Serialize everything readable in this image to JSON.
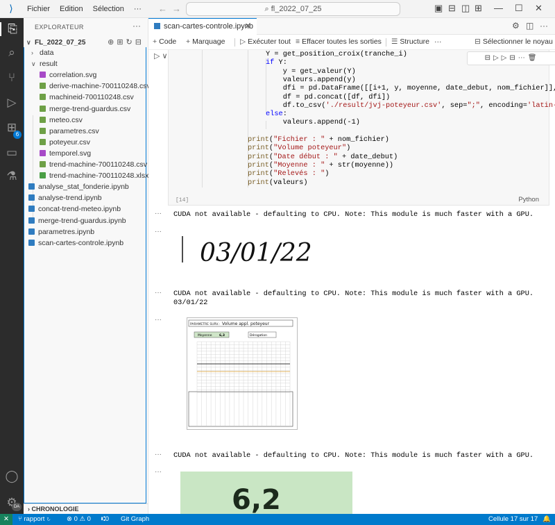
{
  "titlebar": {
    "menus": [
      "Fichier",
      "Edition",
      "Sélection",
      "···"
    ],
    "search": "fl_2022_07_25"
  },
  "sidebar": {
    "title": "EXPLORATEUR",
    "folder": "FL_2022_07_25",
    "items": [
      {
        "label": "data",
        "type": "folder-collapsed"
      },
      {
        "label": "result",
        "type": "folder-open"
      },
      {
        "label": "correlation.svg",
        "type": "svg"
      },
      {
        "label": "derive-machine-700110248.csv",
        "type": "csv"
      },
      {
        "label": "machineid-700110248.csv",
        "type": "csv"
      },
      {
        "label": "merge-trend-guardus.csv",
        "type": "csv"
      },
      {
        "label": "meteo.csv",
        "type": "csv"
      },
      {
        "label": "parametres.csv",
        "type": "csv"
      },
      {
        "label": "poteyeur.csv",
        "type": "csv"
      },
      {
        "label": "temporel.svg",
        "type": "svg"
      },
      {
        "label": "trend-machine-700110248.csv",
        "type": "csv"
      },
      {
        "label": "trend-machine-700110248.xlsx",
        "type": "xl"
      },
      {
        "label": "analyse_stat_fonderie.ipynb",
        "type": "nb"
      },
      {
        "label": "analyse-trend.ipynb",
        "type": "nb"
      },
      {
        "label": "concat-trend-meteo.ipynb",
        "type": "nb"
      },
      {
        "label": "merge-trend-guardus.ipynb",
        "type": "nb"
      },
      {
        "label": "parametres.ipynb",
        "type": "nb"
      },
      {
        "label": "scan-cartes-controle.ipynb",
        "type": "nb"
      }
    ],
    "chronologie": "CHRONOLOGIE"
  },
  "activity": {
    "badge": "6",
    "account_badge": "DA"
  },
  "tab": {
    "label": "scan-cartes-controle.ipynb"
  },
  "toolbar": {
    "code": "Code",
    "markdown": "Marquage",
    "run_all": "Exécuter tout",
    "clear": "Effacer toutes les sorties",
    "outline": "Structure",
    "kernel": "Sélectionner le noyau"
  },
  "cell": {
    "exec_count": "[14]",
    "language": "Python",
    "lines": [
      "Y = get_position_croix(tranche_i)",
      "if Y:",
      "    y = get_valeur(Y)",
      "    valeurs.append(y)",
      "    dfi = pd.DataFrame([[i+1, y, moyenne, date_debut, nom_fichier]], col",
      "    df = pd.concat([df, dfi])",
      "    df.to_csv('./result/jvj-poteyeur.csv', sep=\";\", encoding='latin-1')",
      "else:",
      "    valeurs.append(-1)",
      "",
      "print(\"Fichier : \" + nom_fichier)",
      "print(\"Volume poteyeur\")",
      "print(\"Date début : \" + date_debut)",
      "print(\"Moyenne : \" + str(moyenne))",
      "print(\"Relevés : \")",
      "print(valeurs)"
    ]
  },
  "outputs": {
    "cuda_msg": "CUDA not available - defaulting to CPU. Note: This module is much faster with a GPU.",
    "date_text": "03/01/22",
    "handwritten": "03/01/22",
    "chart_header": "Volume appl. poteyeur",
    "chart_param": "PARAMETRE SURV.:",
    "chart_moyenne": "Moyenne",
    "chart_moyenne_val": "6,3",
    "chart_derog": "Dérogation",
    "big_value": "6,2"
  },
  "statusbar": {
    "branch": "rapport",
    "problems": "⊗ 0 ⚠ 0",
    "ports": "0",
    "git_graph": "Git Graph",
    "cell": "Cellule 17 sur 17"
  }
}
